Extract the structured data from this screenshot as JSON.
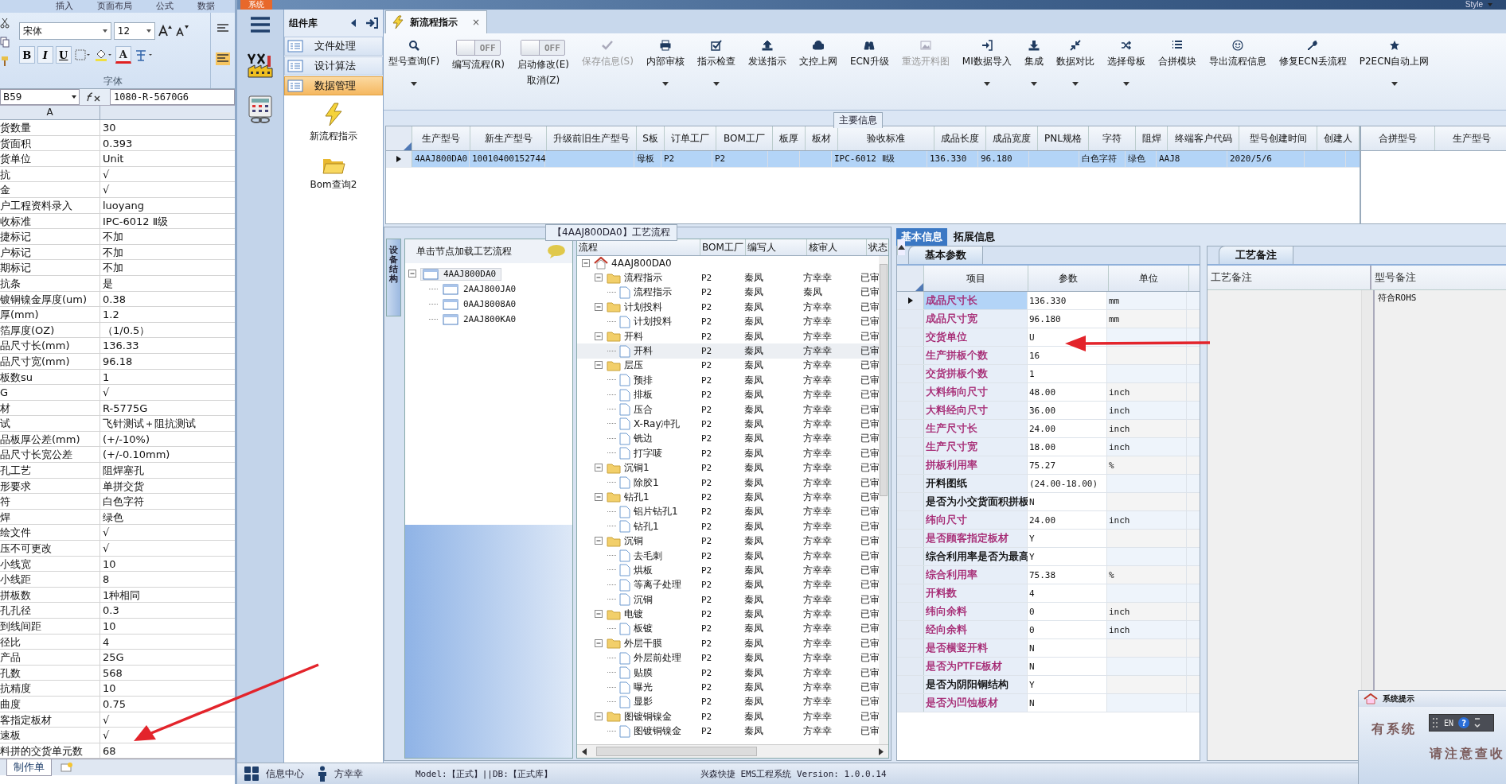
{
  "excel": {
    "ribbon_tabs": [
      "插入",
      "页面布局",
      "公式",
      "数据"
    ],
    "font_name": "宋体",
    "font_size": "12",
    "format_buttons": [
      "B",
      "I",
      "U"
    ],
    "font_color_letter": "A",
    "group_label": "字体",
    "name_box": "B59",
    "formula": "1080-R-5670G6",
    "column_header": "A",
    "rows": [
      {
        "label": "货数量",
        "value": "30"
      },
      {
        "label": "货面积",
        "value": "0.393"
      },
      {
        "label": "货单位",
        "value": "Unit"
      },
      {
        "label": "抗",
        "value": "√"
      },
      {
        "label": "金",
        "value": "√"
      },
      {
        "label": "户工程资料录入",
        "value": "luoyang"
      },
      {
        "label": "收标准",
        "value": "IPC-6012 Ⅱ级"
      },
      {
        "label": "捷标记",
        "value": "不加"
      },
      {
        "label": "户标记",
        "value": "不加"
      },
      {
        "label": "期标记",
        "value": "不加"
      },
      {
        "label": "抗条",
        "value": "是"
      },
      {
        "label": "镀铜镍金厚度(um)",
        "value": "0.38"
      },
      {
        "label": "厚(mm)",
        "value": "1.2"
      },
      {
        "label": "箔厚度(OZ)",
        "value": "（1/0.5）"
      },
      {
        "label": "品尺寸长(mm)",
        "value": "136.33"
      },
      {
        "label": "品尺寸宽(mm)",
        "value": "96.18"
      },
      {
        "label": "板数su",
        "value": "1"
      },
      {
        "label": "G",
        "value": "√"
      },
      {
        "label": "材",
        "value": "R-5775G"
      },
      {
        "label": "试",
        "value": "飞针测试＋阻抗测试"
      },
      {
        "label": "品板厚公差(mm)",
        "value": "(+/-10%)"
      },
      {
        "label": "品尺寸长宽公差",
        "value": "(+/-0.10mm)"
      },
      {
        "label": "孔工艺",
        "value": "阻焊塞孔"
      },
      {
        "label": "形要求",
        "value": "单拼交货"
      },
      {
        "label": "符",
        "value": "白色字符"
      },
      {
        "label": "焊",
        "value": "绿色"
      },
      {
        "label": "绘文件",
        "value": "√"
      },
      {
        "label": "压不可更改",
        "value": "√"
      },
      {
        "label": "小线宽",
        "value": "10"
      },
      {
        "label": "小线距",
        "value": "8"
      },
      {
        "label": "拼板数",
        "value": "1种相同"
      },
      {
        "label": "孔孔径",
        "value": "0.3"
      },
      {
        "label": "到线间距",
        "value": "10"
      },
      {
        "label": "径比",
        "value": "4"
      },
      {
        "label": "产品",
        "value": "25G"
      },
      {
        "label": "孔数",
        "value": "568"
      },
      {
        "label": "抗精度",
        "value": "10"
      },
      {
        "label": "曲度",
        "value": "0.75"
      },
      {
        "label": "客指定板材",
        "value": "√"
      },
      {
        "label": "速板",
        "value": "√"
      },
      {
        "label": "料拼的交货单元数",
        "value": "68"
      }
    ],
    "sheet_tab": "制作单"
  },
  "title_strip": {
    "menu_tab": "系统",
    "style_button": "Style"
  },
  "component_panel": {
    "title": "组件库",
    "items": [
      {
        "label": "文件处理",
        "selected": false
      },
      {
        "label": "设计算法",
        "selected": false
      },
      {
        "label": "数据管理",
        "selected": true
      }
    ],
    "tools": [
      "新流程指示",
      "Bom查询2"
    ]
  },
  "document_tab": {
    "label": "新流程指示",
    "close": "×"
  },
  "toolbar": [
    {
      "kind": "button",
      "label": "型号查询(F)",
      "disabled": false,
      "dropdown": true
    },
    {
      "kind": "toggle",
      "label": "编写流程(R)",
      "switch": "OFF",
      "on": false
    },
    {
      "kind": "toggle",
      "label": "启动修改(E)",
      "sublabel": "取消(Z)",
      "switch": "OFF",
      "on": false
    },
    {
      "kind": "button",
      "label": "保存信息(S)",
      "disabled": true,
      "dropdown": false
    },
    {
      "kind": "button",
      "label": "内部审核",
      "disabled": false,
      "dropdown": true
    },
    {
      "kind": "button",
      "label": "指示检查",
      "disabled": false,
      "dropdown": true
    },
    {
      "kind": "button",
      "label": "发送指示",
      "disabled": false,
      "dropdown": false
    },
    {
      "kind": "button",
      "label": "文控上网",
      "disabled": false,
      "dropdown": false
    },
    {
      "kind": "button",
      "label": "ECN升级",
      "disabled": false,
      "dropdown": false
    },
    {
      "kind": "button",
      "label": "重选开料图",
      "disabled": true,
      "dropdown": false
    },
    {
      "kind": "button",
      "label": "MI数据导入",
      "disabled": false,
      "dropdown": true
    },
    {
      "kind": "button",
      "label": "集成",
      "disabled": false,
      "dropdown": true
    },
    {
      "kind": "button",
      "label": "数据对比",
      "disabled": false,
      "dropdown": true
    },
    {
      "kind": "button",
      "label": "选择母板",
      "disabled": false,
      "dropdown": true
    },
    {
      "kind": "button",
      "label": "合拼模块",
      "disabled": false,
      "dropdown": false
    },
    {
      "kind": "button",
      "label": "导出流程信息",
      "disabled": false,
      "dropdown": false
    },
    {
      "kind": "button",
      "label": "修复ECN丢流程",
      "disabled": false,
      "dropdown": false
    },
    {
      "kind": "button",
      "label": "P2ECN自动上网",
      "disabled": false,
      "dropdown": true
    }
  ],
  "main_info": {
    "title": "主要信息",
    "columns": [
      "生产型号",
      "新生产型号",
      "升级前旧生产型号",
      "S板",
      "订单工厂",
      "BOM工厂",
      "板厚",
      "板材",
      "验收标准",
      "成品长度",
      "成品宽度",
      "PNL规格",
      "字符",
      "阻焊",
      "终端客户代码",
      "型号创建时间",
      "创建人"
    ],
    "rows": [
      {
        "selected": true,
        "cells": [
          "4AAJ800DA0",
          "10010400152744",
          null,
          "母板",
          "P2",
          "P2",
          null,
          null,
          "IPC-6012 Ⅱ级",
          "136.330",
          "96.180",
          null,
          "白色字符",
          "绿色",
          "AAJ8",
          "2020/5/6",
          null
        ]
      }
    ],
    "merge_columns": [
      "合拼型号",
      "生产型号"
    ]
  },
  "device_tree": {
    "side_tab": "设备结构",
    "header": "单击节点加载工艺流程",
    "root": {
      "label": "4AAJ800DA0",
      "selected": true,
      "expanded": true,
      "children": [
        {
          "label": "2AAJ800JA0",
          "selected": false
        },
        {
          "label": "0AAJ8008A0",
          "selected": false
        },
        {
          "label": "2AAJ800KA0",
          "selected": false
        }
      ]
    }
  },
  "flow": {
    "title": "【4AAJ800DA0】工艺流程",
    "columns": [
      "流程",
      "BOM工厂",
      "编写人",
      "核审人",
      "状态"
    ],
    "tree": {
      "kind": "root",
      "label": "4AAJ800DA0",
      "selected": false,
      "expanded": true,
      "children": [
        {
          "kind": "folder",
          "label": "流程指示",
          "bom": "P2",
          "writer": "秦凤",
          "reviewer": "方幸幸",
          "status": "已审",
          "selected": false,
          "expanded": true,
          "children": [
            {
              "kind": "doc",
              "label": "流程指示",
              "bom": "P2",
              "writer": "秦凤",
              "reviewer": "秦凤",
              "status": "已审",
              "selected": false
            }
          ]
        },
        {
          "kind": "folder",
          "label": "计划投料",
          "bom": "P2",
          "writer": "秦凤",
          "reviewer": "方幸幸",
          "status": "已审",
          "selected": false,
          "expanded": true,
          "children": [
            {
              "kind": "doc",
              "label": "计划投料",
              "bom": "P2",
              "writer": "秦凤",
              "reviewer": "方幸幸",
              "status": "已审",
              "selected": false
            }
          ]
        },
        {
          "kind": "folder",
          "label": "开料",
          "bom": "P2",
          "writer": "秦凤",
          "reviewer": "方幸幸",
          "status": "已审",
          "selected": false,
          "expanded": true,
          "children": [
            {
              "kind": "doc",
              "label": "开料",
              "bom": "P2",
              "writer": "秦凤",
              "reviewer": "方幸幸",
              "status": "已审",
              "selected": true
            }
          ]
        },
        {
          "kind": "folder",
          "label": "层压",
          "bom": "P2",
          "writer": "秦凤",
          "reviewer": "方幸幸",
          "status": "已审",
          "selected": false,
          "expanded": true,
          "children": [
            {
              "kind": "doc",
              "label": "预排",
              "bom": "P2",
              "writer": "秦凤",
              "reviewer": "方幸幸",
              "status": "已审",
              "selected": false
            },
            {
              "kind": "doc",
              "label": "排板",
              "bom": "P2",
              "writer": "秦凤",
              "reviewer": "方幸幸",
              "status": "已审",
              "selected": false
            },
            {
              "kind": "doc",
              "label": "压合",
              "bom": "P2",
              "writer": "秦凤",
              "reviewer": "方幸幸",
              "status": "已审",
              "selected": false
            },
            {
              "kind": "doc",
              "label": "X-Ray冲孔",
              "bom": "P2",
              "writer": "秦凤",
              "reviewer": "方幸幸",
              "status": "已审",
              "selected": false
            },
            {
              "kind": "doc",
              "label": "铣边",
              "bom": "P2",
              "writer": "秦凤",
              "reviewer": "方幸幸",
              "status": "已审",
              "selected": false
            },
            {
              "kind": "doc",
              "label": "打字唛",
              "bom": "P2",
              "writer": "秦凤",
              "reviewer": "方幸幸",
              "status": "已审",
              "selected": false
            }
          ]
        },
        {
          "kind": "folder",
          "label": "沉铜1",
          "bom": "P2",
          "writer": "秦凤",
          "reviewer": "方幸幸",
          "status": "已审",
          "selected": false,
          "expanded": true,
          "children": [
            {
              "kind": "doc",
              "label": "除胶1",
              "bom": "P2",
              "writer": "秦凤",
              "reviewer": "方幸幸",
              "status": "已审",
              "selected": false
            }
          ]
        },
        {
          "kind": "folder",
          "label": "钻孔1",
          "bom": "P2",
          "writer": "秦凤",
          "reviewer": "方幸幸",
          "status": "已审",
          "selected": false,
          "expanded": true,
          "children": [
            {
              "kind": "doc",
              "label": "铝片钻孔1",
              "bom": "P2",
              "writer": "秦凤",
              "reviewer": "方幸幸",
              "status": "已审",
              "selected": false
            },
            {
              "kind": "doc",
              "label": "钻孔1",
              "bom": "P2",
              "writer": "秦凤",
              "reviewer": "方幸幸",
              "status": "已审",
              "selected": false
            }
          ]
        },
        {
          "kind": "folder",
          "label": "沉铜",
          "bom": "P2",
          "writer": "秦凤",
          "reviewer": "方幸幸",
          "status": "已审",
          "selected": false,
          "expanded": true,
          "children": [
            {
              "kind": "doc",
              "label": "去毛刺",
              "bom": "P2",
              "writer": "秦凤",
              "reviewer": "方幸幸",
              "status": "已审",
              "selected": false
            },
            {
              "kind": "doc",
              "label": "烘板",
              "bom": "P2",
              "writer": "秦凤",
              "reviewer": "方幸幸",
              "status": "已审",
              "selected": false
            },
            {
              "kind": "doc",
              "label": "等离子处理",
              "bom": "P2",
              "writer": "秦凤",
              "reviewer": "方幸幸",
              "status": "已审",
              "selected": false
            },
            {
              "kind": "doc",
              "label": "沉铜",
              "bom": "P2",
              "writer": "秦凤",
              "reviewer": "方幸幸",
              "status": "已审",
              "selected": false
            }
          ]
        },
        {
          "kind": "folder",
          "label": "电镀",
          "bom": "P2",
          "writer": "秦凤",
          "reviewer": "方幸幸",
          "status": "已审",
          "selected": false,
          "expanded": true,
          "children": [
            {
              "kind": "doc",
              "label": "板镀",
              "bom": "P2",
              "writer": "秦凤",
              "reviewer": "方幸幸",
              "status": "已审",
              "selected": false
            }
          ]
        },
        {
          "kind": "folder",
          "label": "外层干膜",
          "bom": "P2",
          "writer": "秦凤",
          "reviewer": "方幸幸",
          "status": "已审",
          "selected": false,
          "expanded": true,
          "children": [
            {
              "kind": "doc",
              "label": "外层前处理",
              "bom": "P2",
              "writer": "秦凤",
              "reviewer": "方幸幸",
              "status": "已审",
              "selected": false
            },
            {
              "kind": "doc",
              "label": "贴膜",
              "bom": "P2",
              "writer": "秦凤",
              "reviewer": "方幸幸",
              "status": "已审",
              "selected": false
            },
            {
              "kind": "doc",
              "label": "曝光",
              "bom": "P2",
              "writer": "秦凤",
              "reviewer": "方幸幸",
              "status": "已审",
              "selected": false
            },
            {
              "kind": "doc",
              "label": "显影",
              "bom": "P2",
              "writer": "秦凤",
              "reviewer": "方幸幸",
              "status": "已审",
              "selected": false
            }
          ]
        },
        {
          "kind": "folder",
          "label": "图镀铜镍金",
          "bom": "P2",
          "writer": "秦凤",
          "reviewer": "方幸幸",
          "status": "已审",
          "selected": false,
          "expanded": true,
          "children": [
            {
              "kind": "doc",
              "label": "图镀铜镍金",
              "bom": "P2",
              "writer": "秦凤",
              "reviewer": "方幸幸",
              "status": "已审",
              "selected": false
            }
          ]
        }
      ]
    }
  },
  "info_tabs": [
    {
      "label": "基本信息",
      "selected": true
    },
    {
      "label": "拓展信息",
      "selected": false
    }
  ],
  "params": {
    "tab": "基本参数",
    "columns": [
      "项目",
      "参数",
      "单位"
    ],
    "rows": [
      {
        "label": "成品尺寸长",
        "value": "136.330",
        "unit": "mm",
        "color": "#a3216e",
        "selected": true
      },
      {
        "label": "成品尺寸宽",
        "value": "96.180",
        "unit": "mm",
        "color": "#a3216e",
        "selected": false
      },
      {
        "label": "交货单位",
        "value": "U",
        "color": "#a3216e",
        "selected": false
      },
      {
        "label": "生产拼板个数",
        "value": "16",
        "color": "#a3216e",
        "selected": false
      },
      {
        "label": "交货拼板个数",
        "value": "1",
        "color": "#a3216e",
        "selected": false
      },
      {
        "label": "大料纬向尺寸",
        "value": "48.00",
        "unit": "inch",
        "color": "#a3216e",
        "selected": false
      },
      {
        "label": "大料经向尺寸",
        "value": "36.00",
        "unit": "inch",
        "color": "#a3216e",
        "selected": false
      },
      {
        "label": "生产尺寸长",
        "value": "24.00",
        "unit": "inch",
        "color": "#a3216e",
        "selected": false
      },
      {
        "label": "生产尺寸宽",
        "value": "18.00",
        "unit": "inch",
        "color": "#a3216e",
        "selected": false
      },
      {
        "label": "拼板利用率",
        "value": "75.27",
        "unit": "%",
        "color": "#a3216e",
        "selected": false
      },
      {
        "label": "开料图纸",
        "value": "(24.00-18.00)",
        "color": "#000000",
        "selected": false
      },
      {
        "label": "是否为小交货面积拼板",
        "value": "N",
        "color": "#000000",
        "selected": false
      },
      {
        "label": "纬向尺寸",
        "value": "24.00",
        "unit": "inch",
        "color": "#a3216e",
        "selected": false
      },
      {
        "label": "是否顾客指定板材",
        "value": "Y",
        "color": "#a3216e",
        "selected": false
      },
      {
        "label": "综合利用率是否为最高",
        "value": "Y",
        "color": "#000000",
        "selected": false
      },
      {
        "label": "综合利用率",
        "value": "75.38",
        "unit": "%",
        "color": "#a3216e",
        "selected": false
      },
      {
        "label": "开料数",
        "value": "4",
        "color": "#a3216e",
        "selected": false
      },
      {
        "label": "纬向余料",
        "value": "0",
        "unit": "inch",
        "color": "#a3216e",
        "selected": false
      },
      {
        "label": "经向余料",
        "value": "0",
        "unit": "inch",
        "color": "#a3216e",
        "selected": false
      },
      {
        "label": "是否横竖开料",
        "value": "N",
        "color": "#a3216e",
        "selected": false
      },
      {
        "label": "是否为PTFE板材",
        "value": "N",
        "color": "#a3216e",
        "selected": false
      },
      {
        "label": "是否为阴阳铜结构",
        "value": "Y",
        "color": "#000000",
        "selected": false
      },
      {
        "label": "是否为凹蚀板材",
        "value": "N",
        "color": "#a3216e",
        "selected": false
      }
    ]
  },
  "notes": {
    "tab": "工艺备注",
    "columns": [
      "工艺备注",
      "型号备注"
    ],
    "model_note": "符合ROHS"
  },
  "popup": {
    "title": "系统提示",
    "line_1": "有系统",
    "line_2": "请注意查收"
  },
  "language_bar": {
    "label": "EN",
    "help": "?"
  },
  "status_bar": {
    "info_center": "信息中心",
    "user": "方幸幸",
    "model": "Model:【正式】||DB:【正式库】",
    "version": "兴森快捷 EMS工程系统 Version: 1.0.0.14"
  }
}
